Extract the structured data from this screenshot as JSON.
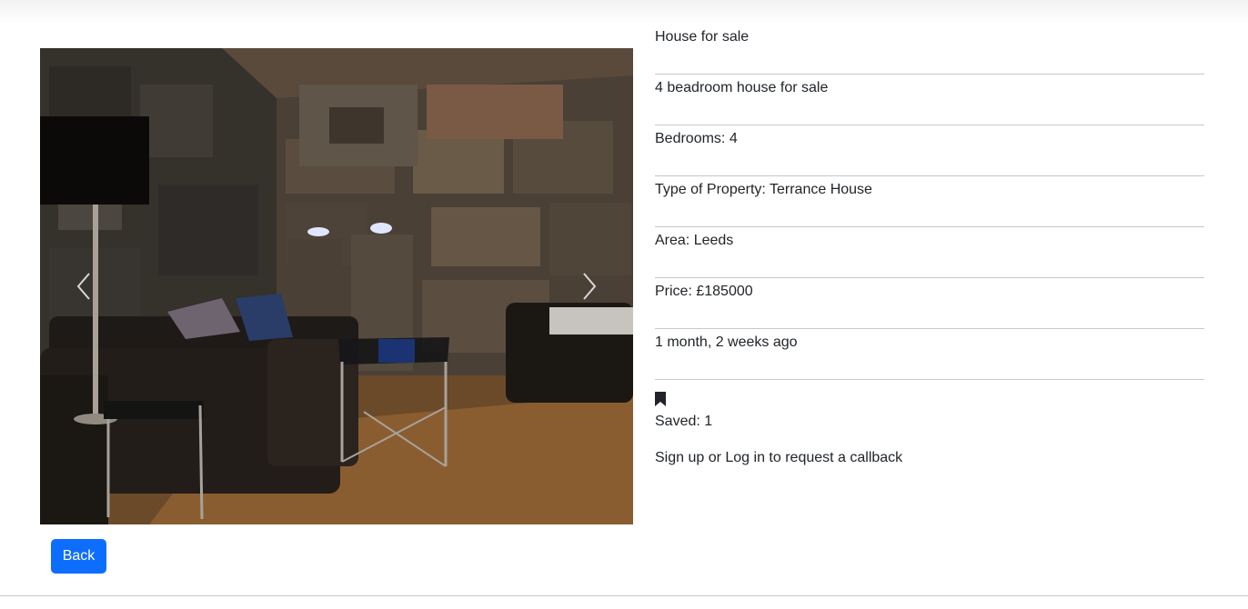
{
  "listing": {
    "title": "House for sale",
    "description": "4 beadroom house for sale",
    "bedrooms": "Bedrooms: 4",
    "property_type": "Type of Property: Terrance House",
    "area": "Area: Leeds",
    "price": "Price: £185000",
    "posted": "1 month, 2 weeks ago"
  },
  "saved": {
    "icon": "bookmark-icon",
    "label": "Saved: 1"
  },
  "callback_text": "Sign up or Log in to request a callback",
  "back_button": "Back",
  "carousel": {
    "prev_icon": "chevron-left-icon",
    "next_icon": "chevron-right-icon"
  },
  "colors": {
    "primary": "#0d6efd",
    "text": "#212529",
    "divider": "#c8c8c8"
  }
}
